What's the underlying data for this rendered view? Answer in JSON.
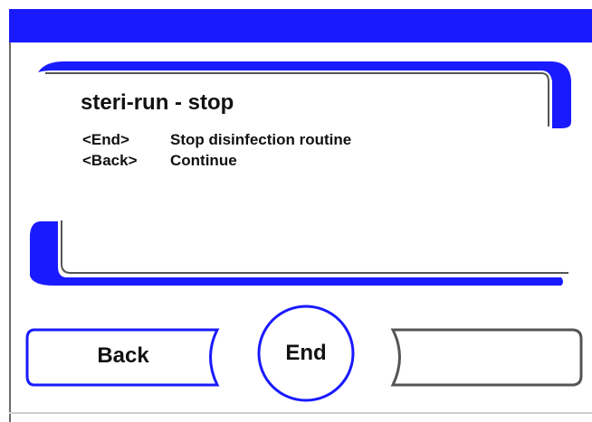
{
  "dialog": {
    "title": "steri-run - stop",
    "instructions": [
      {
        "key": "<End>",
        "text": "Stop disinfection routine"
      },
      {
        "key": "<Back>",
        "text": "Continue"
      }
    ]
  },
  "buttons": {
    "back_label": "Back",
    "end_label": "End",
    "right_label": ""
  },
  "colors": {
    "accent": "#1a1aff",
    "frame_gray": "#555555"
  }
}
